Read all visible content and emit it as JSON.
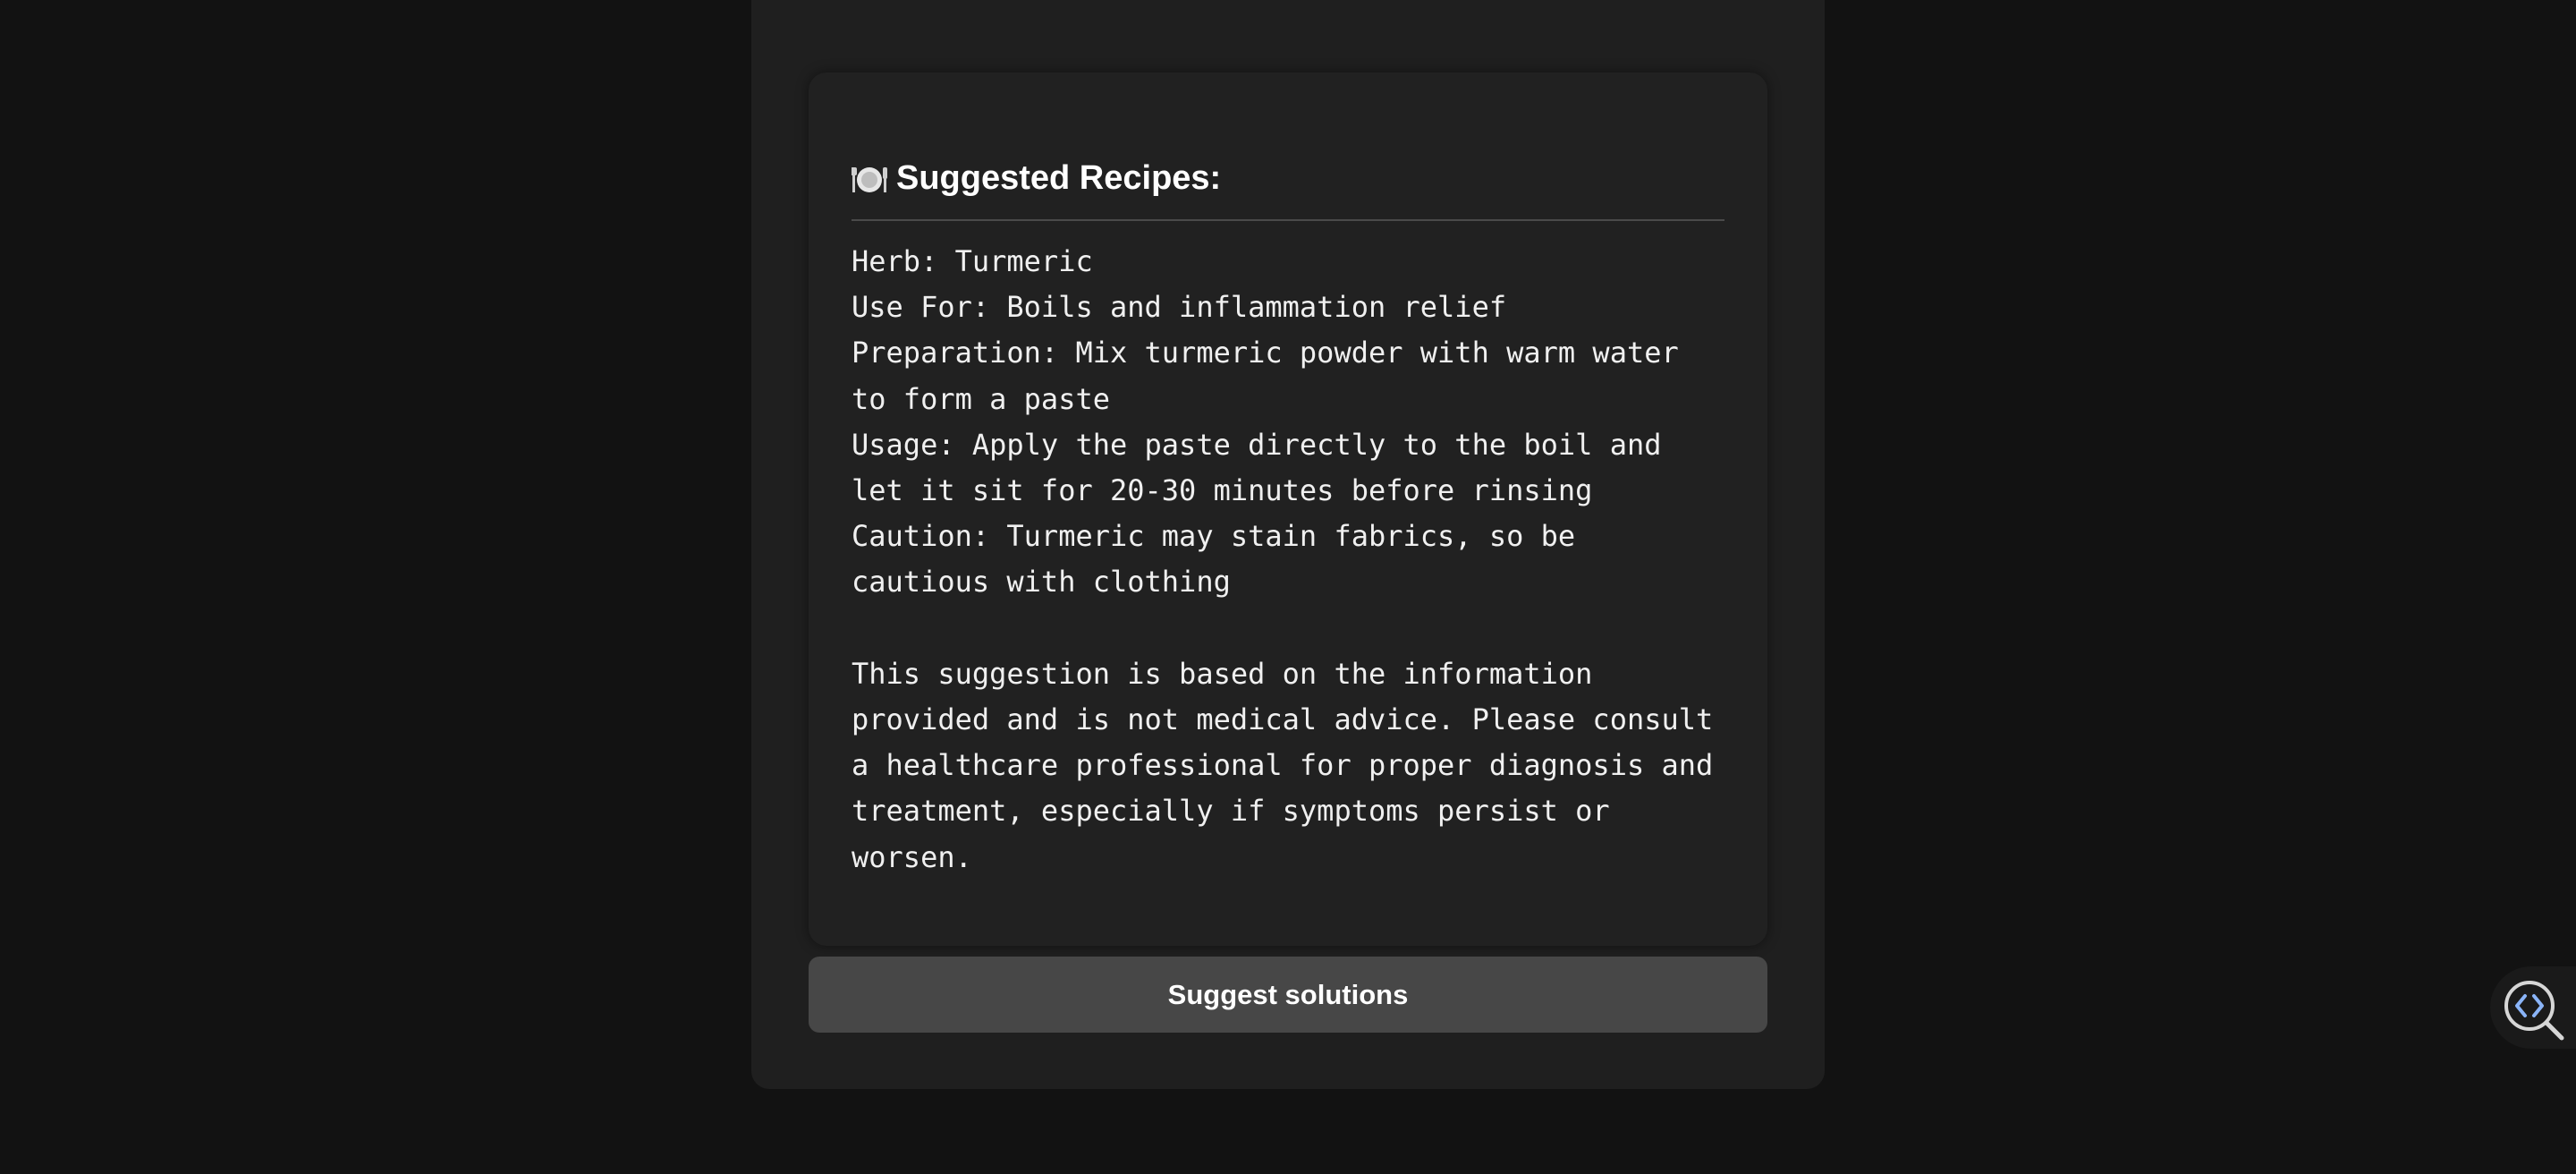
{
  "results": {
    "heading_icon": "plate-cutlery-icon",
    "heading": "Suggested Recipes:",
    "lines": [
      "Herb: Turmeric",
      "Use For: Boils and inflammation relief",
      "Preparation: Mix turmeric powder with warm water to form a paste",
      "Usage: Apply the paste directly to the boil and let it sit for 20-30 minutes before rinsing",
      "Caution: Turmeric may stain fabrics, so be cautious with clothing"
    ],
    "disclaimer": "This suggestion is based on the information provided and is not medical advice. Please consult a healthcare professional for proper diagnosis and treatment, especially if symptoms persist or worsen."
  },
  "actions": {
    "suggest_label": "Suggest solutions"
  },
  "widget": {
    "icon": "code-inspect-icon"
  },
  "colors": {
    "background": "#121212",
    "panel": "#1f1f1f",
    "card": "#212121",
    "button": "#474747",
    "text": "#ffffff",
    "widget_accent": "#8ab4f8"
  }
}
